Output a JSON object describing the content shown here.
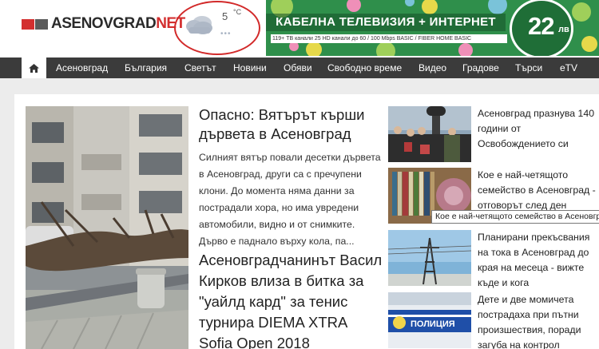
{
  "header": {
    "logo_main": "ASENOVGRAD",
    "logo_accent": "NET",
    "weather": {
      "temp": "5",
      "unit": "°C",
      "icon": "cloudy-icon",
      "dots": "•••"
    },
    "banner": {
      "title": "КАБЕЛНА ТЕЛЕВИЗИЯ + ИНТЕРНЕТ",
      "subtitle": "119+ ТВ канали 25 HD канали   до 60 / 100 Mbps BASIC / FIBER HOME BASIC",
      "price": "22",
      "currency": "лв"
    }
  },
  "nav": {
    "home_icon": "home-icon",
    "items": [
      {
        "label": "Асеновград"
      },
      {
        "label": "България"
      },
      {
        "label": "Светът"
      },
      {
        "label": "Новини"
      },
      {
        "label": "Обяви"
      },
      {
        "label": "Свободно време"
      },
      {
        "label": "Видео"
      },
      {
        "label": "Градове"
      },
      {
        "label": "Търси"
      },
      {
        "label": "eTV"
      }
    ]
  },
  "lead": {
    "title": "Опасно: Вятърът кърши дървета в Асеновград",
    "text": "Силният вятър повали десетки дървета в Асеновград, други са с пречупени клони. До момента няма данни за пострадали хора, но има увредени автомобили, видно и от снимките. Дърво е паднало върху кола, па..."
  },
  "second": {
    "title": "Асеновградчанинът Васил Кирков влиза в битка за \"уайлд кард\" за тенис турнира DIEMA XTRA Sofia Open 2018"
  },
  "side": [
    {
      "title": "Асеновград празнува 140 години от Освобождението си"
    },
    {
      "title": "Кое е най-четящото семейство в Асеновград - отговорът след ден"
    },
    {
      "title": "Планирани прекъсвания на тока в Асеновград до края на месеца - вижте къде и кога"
    },
    {
      "title": "Дете и две момичета пострадаха при пътни произшествия, поради загуба на контрол"
    }
  ],
  "police_text": "ПОЛИЦИЯ",
  "tooltip": "Кое е най-четящото семейство в Асеновград",
  "colors": {
    "brand_red": "#d32f2f",
    "nav_bg": "#3b3b3b",
    "banner_green": "#2f8f4b"
  }
}
